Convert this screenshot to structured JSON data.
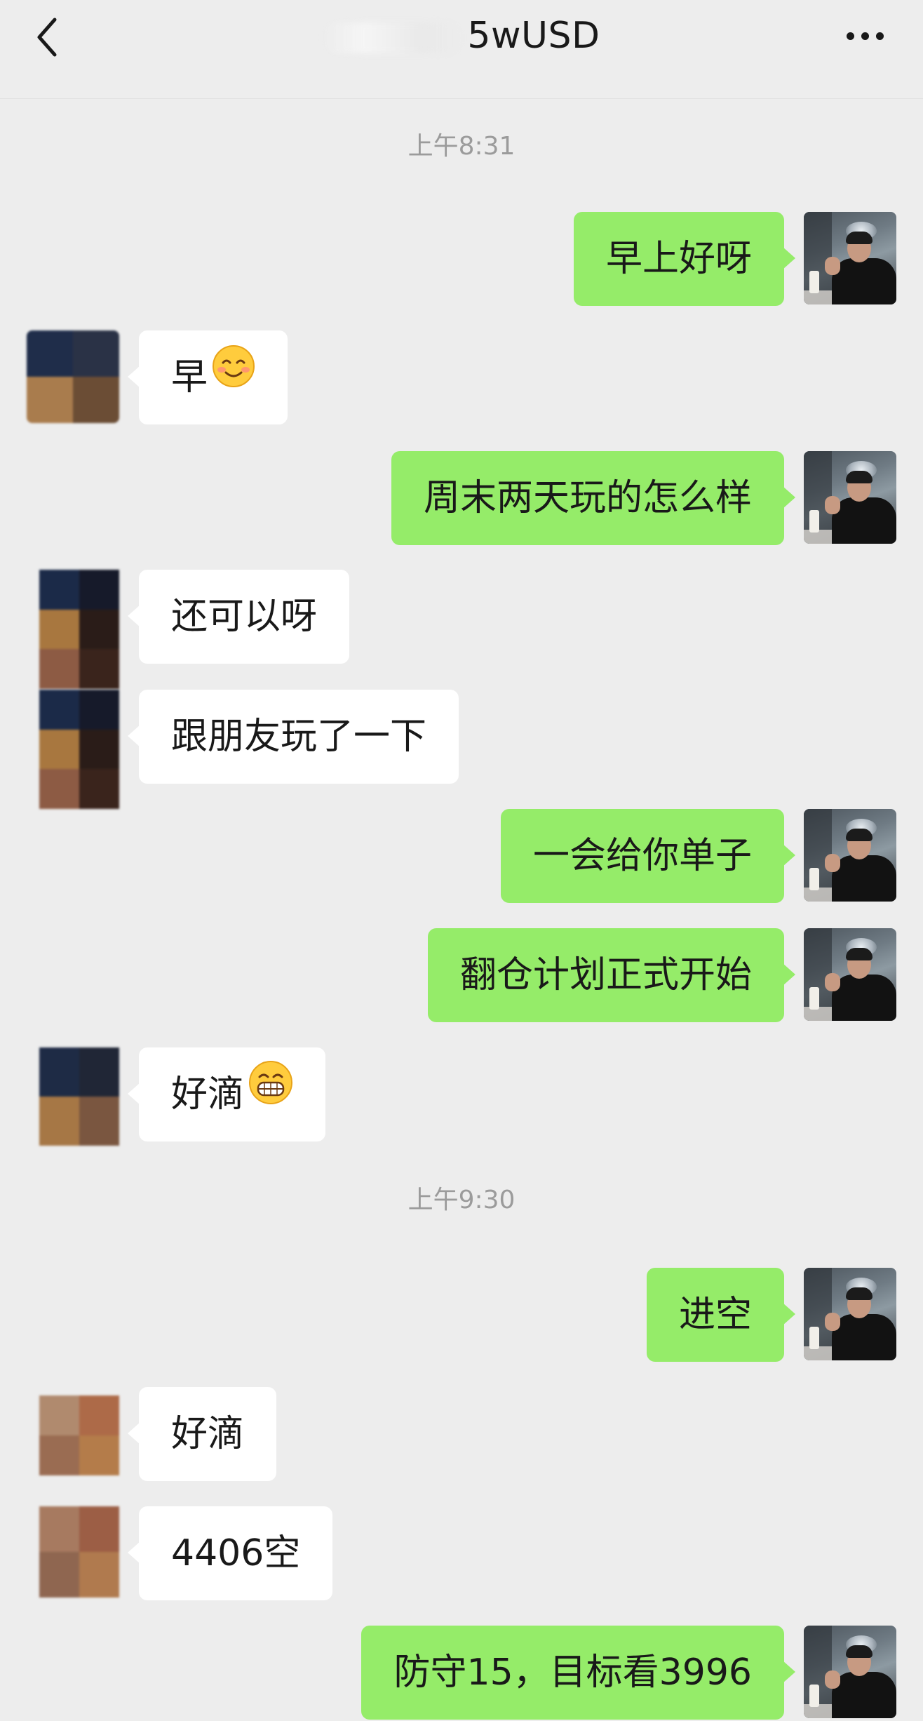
{
  "header": {
    "title": "5wUSD"
  },
  "messages": [
    {
      "kind": "time",
      "text": "上午8:31"
    },
    {
      "kind": "me",
      "text": "早上好呀"
    },
    {
      "kind": "other",
      "text": "早",
      "emoji": "smiling-face"
    },
    {
      "kind": "me",
      "text": "周末两天玩的怎么样"
    },
    {
      "kind": "other",
      "text": "还可以呀"
    },
    {
      "kind": "other",
      "text": "跟朋友玩了一下"
    },
    {
      "kind": "me",
      "text": "一会给你单子"
    },
    {
      "kind": "me",
      "text": "翻仓计划正式开始"
    },
    {
      "kind": "other",
      "text": "好滴",
      "emoji": "grinning-face"
    },
    {
      "kind": "time",
      "text": "上午9:30"
    },
    {
      "kind": "me",
      "text": "进空"
    },
    {
      "kind": "other",
      "text": "好滴"
    },
    {
      "kind": "other",
      "text": "4406空"
    },
    {
      "kind": "me",
      "text": "防守15，目标看3996"
    }
  ],
  "colors": {
    "background": "#ededed",
    "my_bubble": "#95ec69",
    "other_bubble": "#ffffff",
    "timestamp": "#9b9b9b"
  },
  "icons": {
    "back": "back-arrow-icon",
    "more": "more-dots-icon"
  }
}
